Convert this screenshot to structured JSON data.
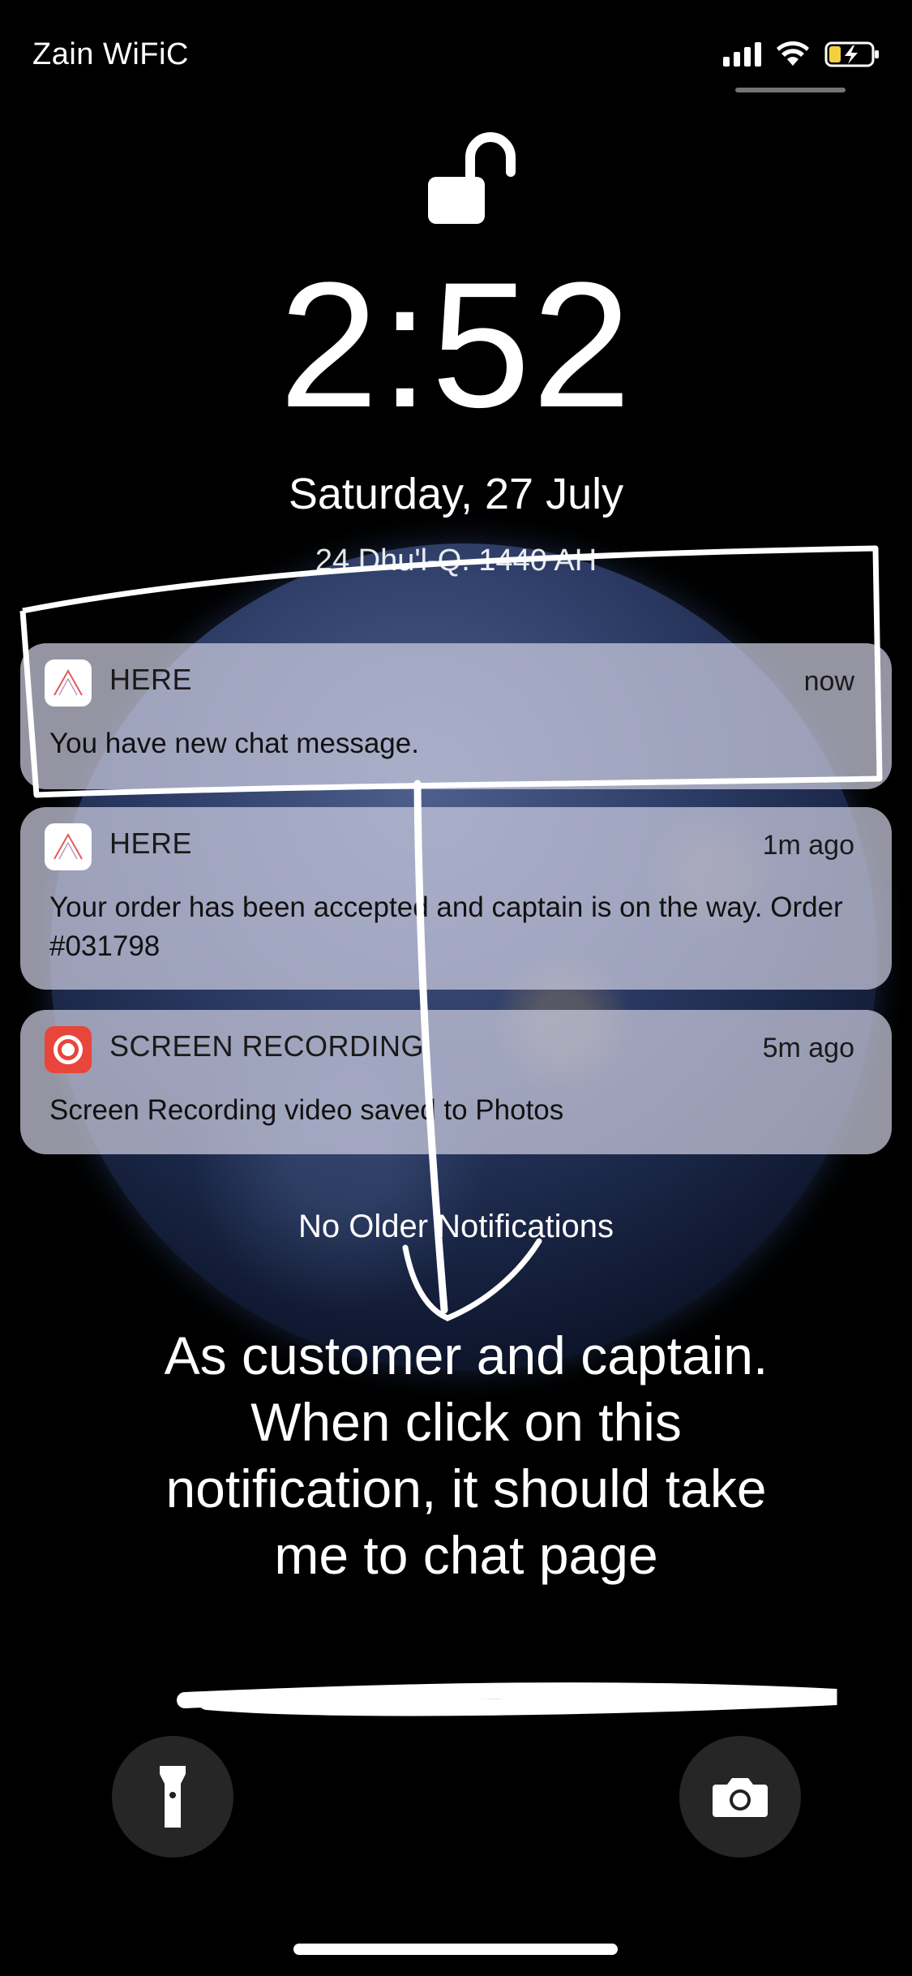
{
  "status_bar": {
    "carrier": "Zain WiFiC",
    "icons": [
      "signal-icon",
      "wifi-icon",
      "battery-charging-icon"
    ],
    "battery_color": "#f4d03f"
  },
  "lock": {
    "icon": "unlocked-padlock-icon",
    "time": "2:52",
    "date": "Saturday, 27 July",
    "hijri_date": "24 Dhu'l-Q. 1440 AH"
  },
  "notifications": [
    {
      "app": "HERE",
      "time": "now",
      "body": "You have new chat message.",
      "icon": "here-app-icon"
    },
    {
      "app": "HERE",
      "time": "1m ago",
      "body": "Your order has been accepted and captain is on the way. Order #031798",
      "icon": "here-app-icon"
    },
    {
      "app": "SCREEN RECORDING",
      "time": "5m ago",
      "body": "Screen Recording video saved to Photos",
      "icon": "screen-recording-icon",
      "icon_color": "#e8453b"
    }
  ],
  "no_older_label": "No Older Notifications",
  "annotation_caption": "As customer and captain. When click on this notification, it should take me to chat page",
  "bottom": {
    "left_icon": "flashlight-icon",
    "right_icon": "camera-icon"
  }
}
